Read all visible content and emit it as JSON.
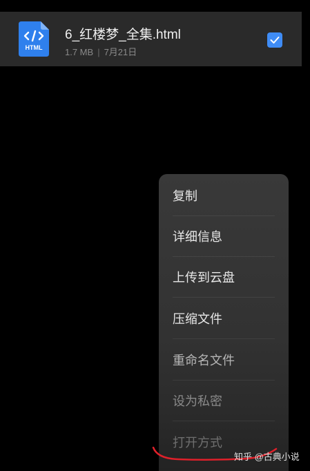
{
  "file": {
    "name": "6_红楼梦_全集.html",
    "size": "1.7 MB",
    "date": "7月21日",
    "icon_label": "HTML",
    "icon_name": "html-file-icon",
    "icon_color": "#2f80ed",
    "selected": true
  },
  "menu": {
    "items": [
      {
        "label": "复制",
        "color": "#e8e8e8"
      },
      {
        "label": "详细信息",
        "color": "#e8e8e8"
      },
      {
        "label": "上传到云盘",
        "color": "#e8e8e8"
      },
      {
        "label": "压缩文件",
        "color": "#e8e8e8"
      },
      {
        "label": "重命名文件",
        "color": "#b5b5b5"
      },
      {
        "label": "设为私密",
        "color": "#8a8a8a"
      },
      {
        "label": "打开方式",
        "color": "#6e6e6e"
      }
    ]
  },
  "watermark": {
    "text": "知乎 @古典小说"
  },
  "colors": {
    "accent": "#3f8cf5",
    "annotation": "#e0202a"
  }
}
